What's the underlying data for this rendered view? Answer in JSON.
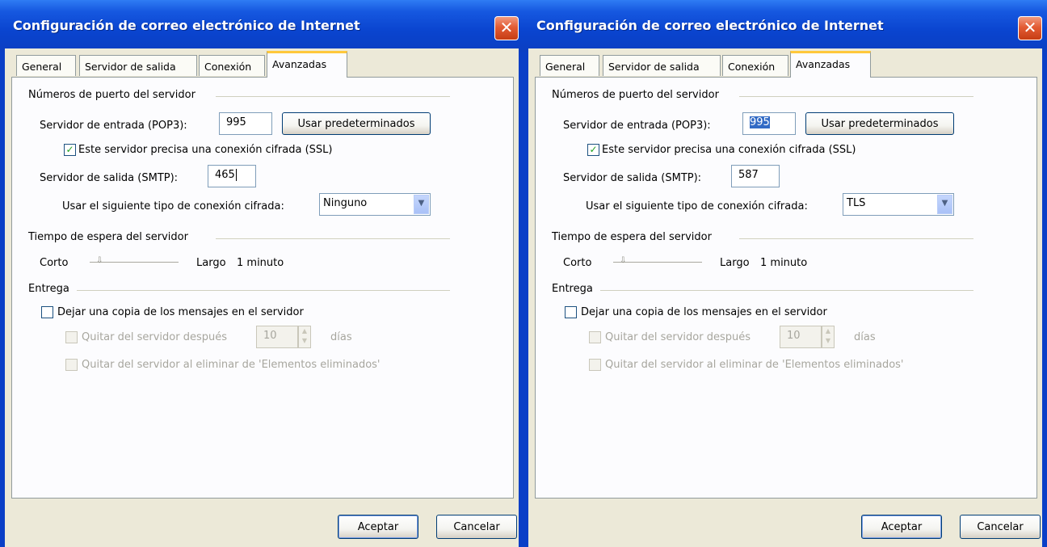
{
  "dialogs": [
    {
      "title": "Configuración de correo electrónico de Internet",
      "close_glyph": "✕",
      "tabs": [
        "General",
        "Servidor de salida",
        "Conexión",
        "Avanzadas"
      ],
      "active_tab": "Avanzadas",
      "ports_group": "Números de puerto del servidor",
      "incoming_label": "Servidor de entrada (POP3):",
      "incoming_value": "995",
      "incoming_selected": false,
      "defaults_button": "Usar predeterminados",
      "ssl_checkbox_label": "Este servidor precisa una conexión cifrada (SSL)",
      "ssl_checked": true,
      "outgoing_label": "Servidor de salida (SMTP):",
      "outgoing_value": "465",
      "outgoing_caret": true,
      "encryption_label": "Usar el siguiente tipo de conexión cifrada:",
      "encryption_value": "Ninguno",
      "timeout_group": "Tiempo de espera del servidor",
      "timeout_short": "Corto",
      "timeout_long": "Largo",
      "timeout_value": "1 minuto",
      "delivery_group": "Entrega",
      "leave_copy_label": "Dejar una copia de los mensajes en el servidor",
      "leave_copy_checked": false,
      "remove_after_label": "Quitar del servidor después",
      "remove_after_days": "10",
      "days_label": "días",
      "remove_deleted_label": "Quitar del servidor al eliminar de 'Elementos eliminados'",
      "ok_button": "Aceptar",
      "cancel_button": "Cancelar"
    },
    {
      "title": "Configuración de correo electrónico de Internet",
      "close_glyph": "✕",
      "tabs": [
        "General",
        "Servidor de salida",
        "Conexión",
        "Avanzadas"
      ],
      "active_tab": "Avanzadas",
      "ports_group": "Números de puerto del servidor",
      "incoming_label": "Servidor de entrada (POP3):",
      "incoming_value": "995",
      "incoming_selected": true,
      "defaults_button": "Usar predeterminados",
      "ssl_checkbox_label": "Este servidor precisa una conexión cifrada (SSL)",
      "ssl_checked": true,
      "outgoing_label": "Servidor de salida (SMTP):",
      "outgoing_value": "587",
      "outgoing_caret": false,
      "encryption_label": "Usar el siguiente tipo de conexión cifrada:",
      "encryption_value": "TLS",
      "timeout_group": "Tiempo de espera del servidor",
      "timeout_short": "Corto",
      "timeout_long": "Largo",
      "timeout_value": "1 minuto",
      "delivery_group": "Entrega",
      "leave_copy_label": "Dejar una copia de los mensajes en el servidor",
      "leave_copy_checked": false,
      "remove_after_label": "Quitar del servidor después",
      "remove_after_days": "10",
      "days_label": "días",
      "remove_deleted_label": "Quitar del servidor al eliminar de 'Elementos eliminados'",
      "ok_button": "Aceptar",
      "cancel_button": "Cancelar"
    }
  ],
  "icons": {
    "checkmark": "✓",
    "dropdown": "▼",
    "spin_up": "▲",
    "spin_down": "▼",
    "slider_thumb": "⇩"
  },
  "colors": {
    "titlebar": "#0a44cf",
    "dialog_face": "#ece9d8",
    "close_button": "#e35c34",
    "tab_highlight": "#ffc83c",
    "selection": "#316ac5",
    "checkmark": "#21a121"
  }
}
